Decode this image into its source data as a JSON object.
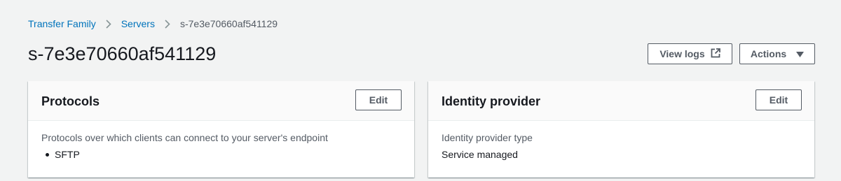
{
  "breadcrumb": {
    "items": [
      "Transfer Family",
      "Servers"
    ],
    "current": "s-7e3e70660af541129"
  },
  "page": {
    "title": "s-7e3e70660af541129"
  },
  "header_actions": {
    "view_logs_label": "View logs",
    "actions_label": "Actions"
  },
  "cards": {
    "protocols": {
      "title": "Protocols",
      "edit_label": "Edit",
      "field_label": "Protocols over which clients can connect to your server's endpoint",
      "values": [
        "SFTP"
      ]
    },
    "identity_provider": {
      "title": "Identity provider",
      "edit_label": "Edit",
      "field_label": "Identity provider type",
      "value": "Service managed"
    }
  },
  "colors": {
    "background": "#f2f3f3",
    "link": "#0073bb",
    "text": "#16191f",
    "secondary_text": "#545b64",
    "card_header": "#fafafa"
  },
  "icons": {
    "breadcrumb_separator": "chevron-right-icon",
    "view_logs": "external-link-icon",
    "actions": "caret-down-icon"
  }
}
